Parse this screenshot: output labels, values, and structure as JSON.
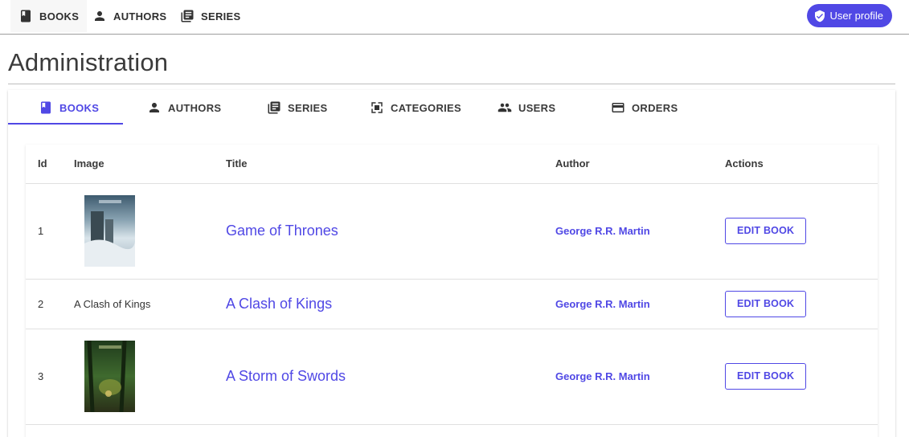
{
  "topnav": {
    "items": [
      {
        "label": "BOOKS",
        "icon": "book-icon"
      },
      {
        "label": "AUTHORS",
        "icon": "person-icon"
      },
      {
        "label": "SERIES",
        "icon": "library-icon"
      }
    ],
    "profile_label": "User profile"
  },
  "page": {
    "title": "Administration"
  },
  "tabs": [
    {
      "label": "BOOKS",
      "icon": "book-icon",
      "active": true
    },
    {
      "label": "AUTHORS",
      "icon": "person-icon"
    },
    {
      "label": "SERIES",
      "icon": "library-icon"
    },
    {
      "label": "CATEGORIES",
      "icon": "category-icon"
    },
    {
      "label": "USERS",
      "icon": "group-icon"
    },
    {
      "label": "ORDERS",
      "icon": "card-icon"
    }
  ],
  "table": {
    "headers": [
      "Id",
      "Image",
      "Title",
      "Author",
      "Actions"
    ],
    "rows": [
      {
        "id": "1",
        "image_alt": "",
        "title": "Game of Thrones",
        "author": "George R.R. Martin",
        "action": "EDIT BOOK"
      },
      {
        "id": "2",
        "image_alt": "A Clash of Kings",
        "title": "A Clash of Kings",
        "author": "George R.R. Martin",
        "action": "EDIT BOOK"
      },
      {
        "id": "3",
        "image_alt": "",
        "title": "A Storm of Swords",
        "author": "George R.R. Martin",
        "action": "EDIT BOOK"
      }
    ]
  },
  "colors": {
    "accent": "#5048e5"
  }
}
